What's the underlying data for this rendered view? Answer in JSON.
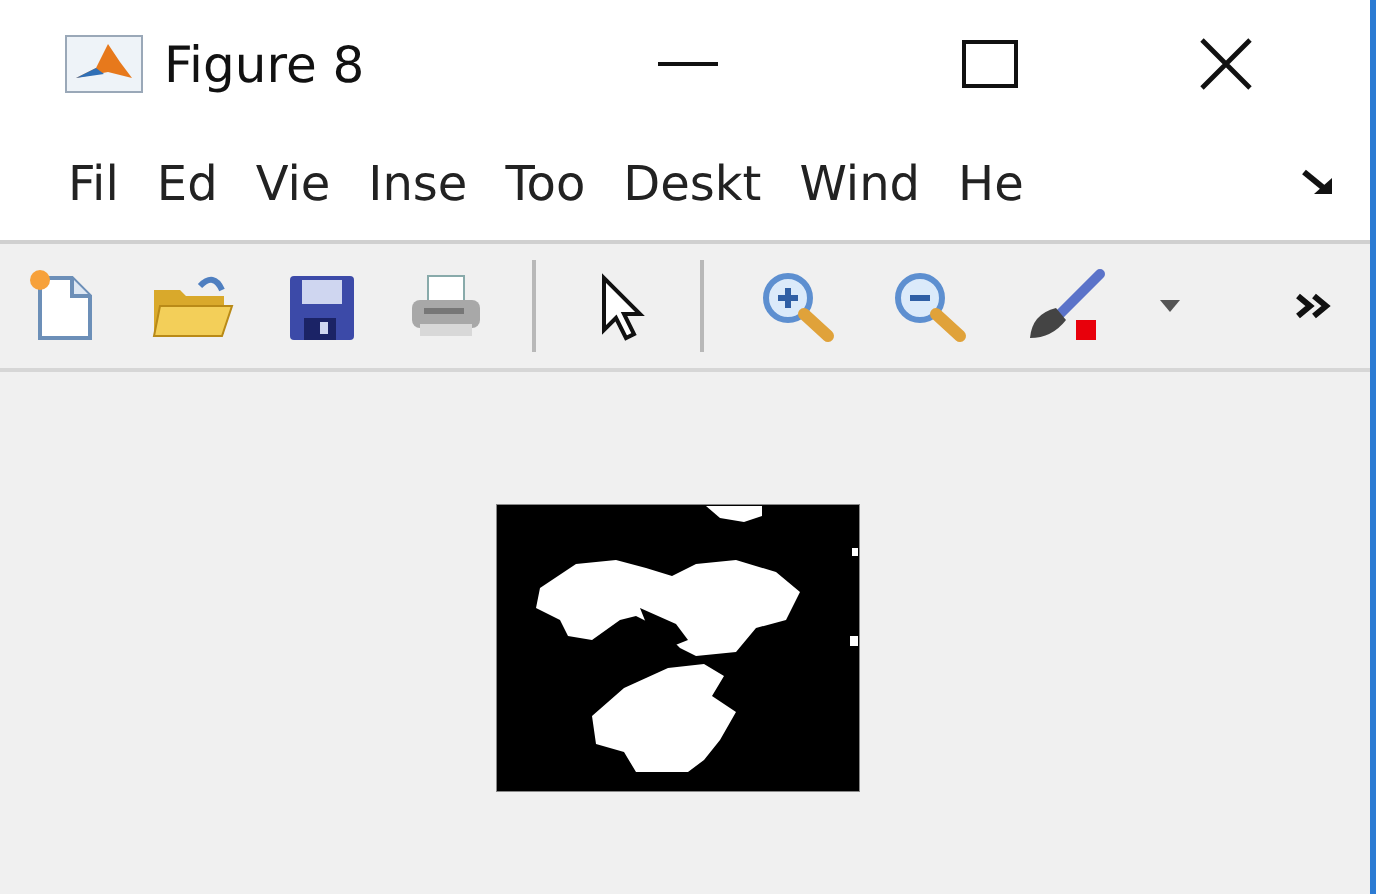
{
  "window": {
    "title": "Figure 8"
  },
  "menu": [
    {
      "label": "Fil"
    },
    {
      "label": "Ed"
    },
    {
      "label": "Vie"
    },
    {
      "label": "Inse"
    },
    {
      "label": "Too"
    },
    {
      "label": "Deskt"
    },
    {
      "label": "Wind"
    },
    {
      "label": "He"
    }
  ]
}
